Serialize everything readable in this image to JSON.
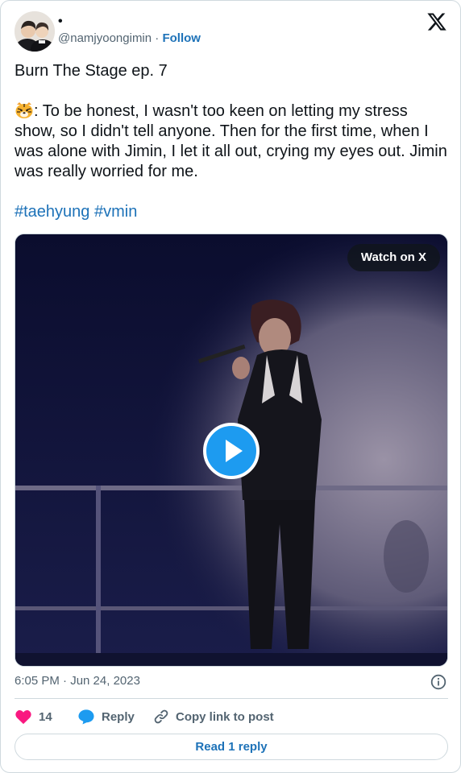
{
  "author": {
    "display_name": "•",
    "handle": "@namjyoongimin",
    "separator": "·",
    "follow_label": "Follow",
    "avatar_icon": "avatar-photo"
  },
  "post": {
    "line1": "Burn The Stage ep. 7",
    "body": ": To be honest, I wasn't too keen on letting my stress show, so I didn't tell anyone. Then for the first time, when I was alone with Jimin, I let it all out, crying my eyes out. Jimin was really worried for me.",
    "emoji_icon": "tiger-face-icon",
    "hashtags": [
      "#taehyung",
      "#vmin"
    ]
  },
  "media": {
    "watch_label": "Watch on X"
  },
  "timestamp": "6:05 PM · Jun 24, 2023",
  "actions": {
    "like_count": "14",
    "reply_label": "Reply",
    "copy_label": "Copy link to post"
  },
  "read_reply_label": "Read 1 reply",
  "colors": {
    "link": "#1d72b8",
    "like": "#f91880",
    "reply_icon": "#1d9bf0",
    "text": "#0f1419",
    "muted": "#536471",
    "border": "#cfd9de"
  }
}
